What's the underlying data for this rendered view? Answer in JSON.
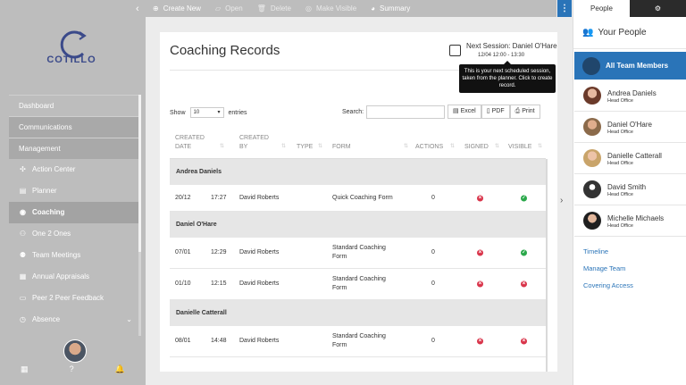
{
  "brand": {
    "name": "COTILLO",
    "color": "#3b4a8a"
  },
  "sidebar": {
    "sections": [
      {
        "label": "Dashboard"
      },
      {
        "label": "Communications"
      },
      {
        "label": "Management"
      }
    ],
    "items": [
      {
        "label": "Action Center",
        "icon": "cross-arrows-icon"
      },
      {
        "label": "Planner",
        "icon": "document-icon"
      },
      {
        "label": "Coaching",
        "icon": "compass-icon"
      },
      {
        "label": "One 2 Ones",
        "icon": "users-icon"
      },
      {
        "label": "Team Meetings",
        "icon": "group-icon"
      },
      {
        "label": "Annual Appraisals",
        "icon": "calendar-icon"
      },
      {
        "label": "Peer 2 Peer Feedback",
        "icon": "chat-icon"
      },
      {
        "label": "Absence",
        "icon": "clock-icon"
      }
    ],
    "active_item": "Coaching",
    "bottom_icons": {
      "grid": "▦",
      "help": "?",
      "bell": "🔔"
    }
  },
  "toolbar": {
    "create_new": "Create New",
    "open": "Open",
    "delete": "Delete",
    "make_visible": "Make Visible",
    "summary": "Summary"
  },
  "main": {
    "title": "Coaching Records",
    "next_session_label": "Next Session: Daniel O'Hare",
    "next_session_time": "12/04  12:00 - 13:30",
    "tooltip": "This is your next scheduled session, taken from the planner. Click to create record.",
    "show_label": "Show",
    "entries_value": "10",
    "entries_label": "entries",
    "search_label": "Search:",
    "export": {
      "excel": "Excel",
      "pdf": "PDF",
      "print": "Print"
    },
    "columns": {
      "created_date_1": "CREATED",
      "created_date_2": "DATE",
      "created_by_1": "CREATED",
      "created_by_2": "BY",
      "type": "TYPE",
      "form": "FORM",
      "actions": "ACTIONS",
      "signed": "SIGNED",
      "visible": "VISIBLE"
    },
    "groups": [
      {
        "name": "Andrea Daniels",
        "rows": [
          {
            "date": "20/12",
            "time": "17:27",
            "by": "David Roberts",
            "form": "Quick Coaching Form",
            "actions": "0",
            "signed": false,
            "visible": true
          }
        ]
      },
      {
        "name": "Daniel O'Hare",
        "rows": [
          {
            "date": "07/01",
            "time": "12:29",
            "by": "David Roberts",
            "form": "Standard Coaching Form",
            "actions": "0",
            "signed": false,
            "visible": true
          },
          {
            "date": "01/10",
            "time": "12:15",
            "by": "David Roberts",
            "form": "Standard Coaching Form",
            "actions": "0",
            "signed": false,
            "visible": false
          }
        ]
      },
      {
        "name": "Danielle Catterall",
        "rows": [
          {
            "date": "08/01",
            "time": "14:48",
            "by": "David Roberts",
            "form": "Standard Coaching Form",
            "actions": "0",
            "signed": false,
            "visible": false
          }
        ]
      }
    ]
  },
  "right_panel": {
    "tab_people": "People",
    "heading": "Your People",
    "all_members": "All Team Members",
    "people": [
      {
        "name": "Andrea Daniels",
        "role": "Head Office"
      },
      {
        "name": "Daniel O'Hare",
        "role": "Head Office"
      },
      {
        "name": "Danielle Catterall",
        "role": "Head Office"
      },
      {
        "name": "David Smith",
        "role": "Head Office"
      },
      {
        "name": "Michelle Michaels",
        "role": "Head Office"
      }
    ],
    "links": [
      "Timeline",
      "Manage Team",
      "Covering Access"
    ]
  },
  "colors": {
    "accent": "#2a74b8",
    "signed_no": "#d9344a",
    "visible_yes": "#2aa84a"
  }
}
